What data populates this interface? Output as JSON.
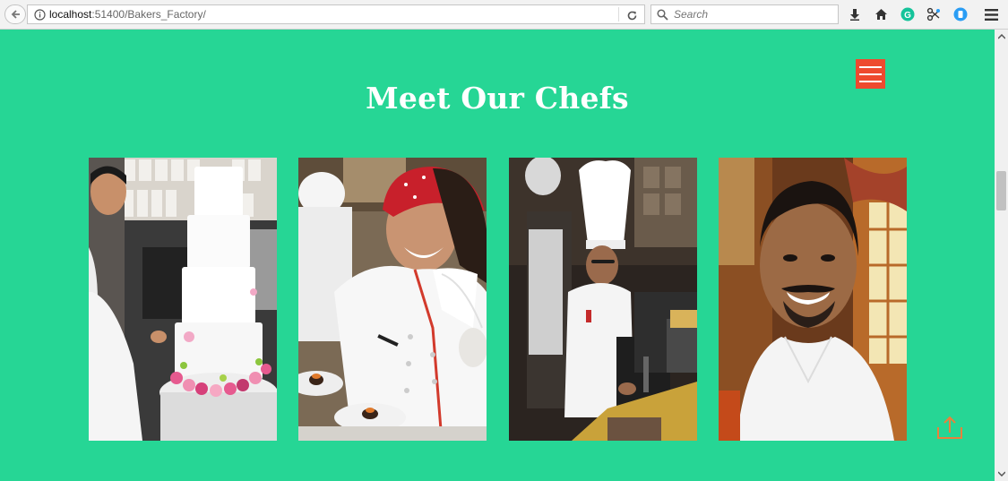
{
  "browser": {
    "url_host": "localhost",
    "url_path": ":51400/Bakers_Factory/",
    "search_placeholder": "Search"
  },
  "page": {
    "section_title": "Meet Our Chefs",
    "background_color": "#26d695",
    "accent_color": "#ee4a2f"
  },
  "chefs": [
    {
      "icon": "cake-decorator-photo"
    },
    {
      "icon": "female-chef-red-bandana-photo"
    },
    {
      "icon": "chef-toque-kitchen-photo"
    },
    {
      "icon": "smiling-chef-portrait-photo"
    }
  ]
}
